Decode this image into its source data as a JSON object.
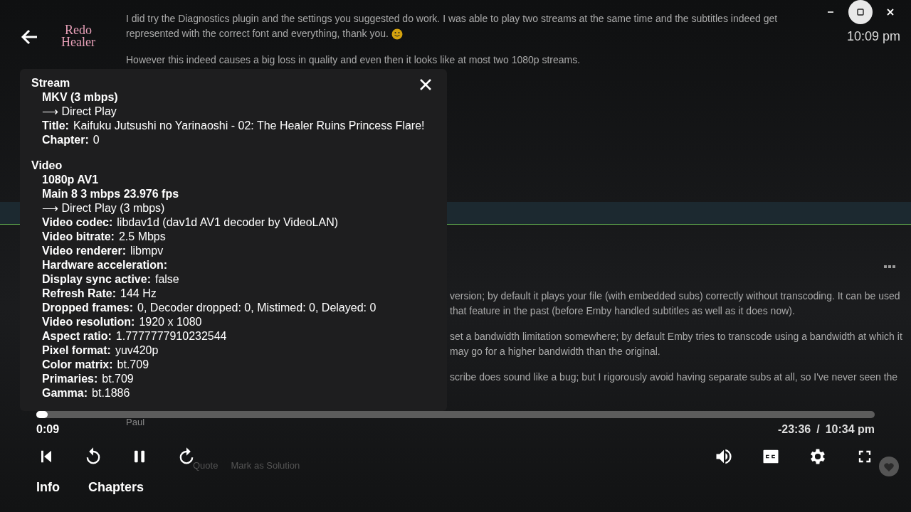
{
  "forum": {
    "post_paragraphs": [
      "I did try the Diagnostics plugin and the settings you suggested do work. I was able to play two streams at the same time and the subtitles indeed get represented with the correct font and everything, thank you.",
      "However this indeed causes a big loss in quality and even then it looks like at most two 1080p streams."
    ],
    "reply_fragments": [
      "version; by default it plays your file (with embedded subs) correctly without transcoding.  It can be used that feature in the past (before Emby handled subtitles as well as it does now).",
      "set a bandwidth limitation somewhere; by default Emby tries to transcode using a bandwidth at which it may go for a higher bandwidth than the original.",
      "scribe does sound like a bug; but I rigorously avoid having separate subs at all, so I've never seen the"
    ],
    "signature": "Paul",
    "actions": [
      "Quote",
      "Mark as Solution"
    ]
  },
  "player": {
    "logo": [
      "Redo",
      "Healer"
    ],
    "clock": "10:09 pm",
    "stats": [
      {
        "heading": "Stream",
        "lines": [
          {
            "kind": "bold",
            "text": "MKV (3 mbps)"
          },
          {
            "kind": "arrow",
            "text": "⟶ Direct Play"
          },
          {
            "kind": "pair",
            "label": "Title:",
            "value": "Kaifuku Jutsushi no Yarinaoshi - 02: The Healer Ruins Princess Flare!"
          },
          {
            "kind": "pair",
            "label": "Chapter:",
            "value": "0"
          }
        ]
      },
      {
        "heading": "Video",
        "lines": [
          {
            "kind": "bold",
            "text": "1080p AV1"
          },
          {
            "kind": "bold",
            "text": "Main 8 3 mbps 23.976 fps"
          },
          {
            "kind": "arrow",
            "text": "⟶ Direct Play (3 mbps)"
          },
          {
            "kind": "pair",
            "label": "Video codec:",
            "value": "libdav1d (dav1d AV1 decoder by VideoLAN)"
          },
          {
            "kind": "pair",
            "label": "Video bitrate:",
            "value": "2.5 Mbps"
          },
          {
            "kind": "pair",
            "label": "Video renderer:",
            "value": "libmpv"
          },
          {
            "kind": "pair",
            "label": "Hardware acceleration:"
          },
          {
            "kind": "pair",
            "label": "Display sync active:",
            "value": "false"
          },
          {
            "kind": "pair",
            "label": "Refresh Rate:",
            "value": "144 Hz"
          },
          {
            "kind": "pair",
            "label": "Dropped frames:",
            "value": "0, Decoder dropped: 0, Mistimed: 0, Delayed: 0"
          },
          {
            "kind": "pair",
            "label": "Video resolution:",
            "value": "1920 x 1080"
          },
          {
            "kind": "pair",
            "label": "Aspect ratio:",
            "value": "1.7777777910232544"
          },
          {
            "kind": "pair",
            "label": "Pixel format:",
            "value": "yuv420p"
          },
          {
            "kind": "pair",
            "label": "Color matrix:",
            "value": "bt.709"
          },
          {
            "kind": "pair",
            "label": "Primaries:",
            "value": "bt.709"
          },
          {
            "kind": "pair",
            "label": "Gamma:",
            "value": "bt.1886"
          }
        ]
      }
    ],
    "progress": {
      "level": 0.006
    },
    "elapsed": "0:09",
    "remaining": "-23:36",
    "separator": "/",
    "end_time": "10:34 pm",
    "tabs": [
      "Info",
      "Chapters"
    ]
  }
}
